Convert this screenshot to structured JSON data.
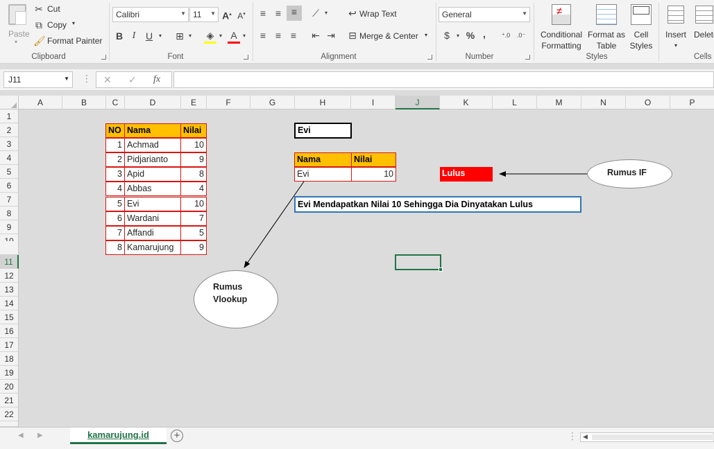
{
  "clipboard": {
    "paste": "Paste",
    "cut": "Cut",
    "copy": "Copy",
    "format_painter": "Format Painter",
    "label": "Clipboard"
  },
  "font": {
    "name": "Calibri",
    "size": "11",
    "label": "Font"
  },
  "alignment": {
    "wrap_text": "Wrap Text",
    "merge_center": "Merge & Center",
    "label": "Alignment"
  },
  "number": {
    "format": "General",
    "label": "Number",
    "currency": "$",
    "percent": "%",
    "comma": ","
  },
  "styles": {
    "conditional": "Conditional",
    "formatting": "Formatting",
    "format_as": "Format as",
    "table": "Table",
    "cell": "Cell",
    "cell_styles": "Styles",
    "label": "Styles"
  },
  "cells": {
    "insert": "Insert",
    "delete": "Delete",
    "label": "Cells"
  },
  "formula_bar": {
    "name_box": "J11",
    "fx": "fx",
    "value": ""
  },
  "columns": [
    "A",
    "B",
    "C",
    "D",
    "E",
    "F",
    "G",
    "H",
    "I",
    "J",
    "K",
    "L",
    "M",
    "N",
    "O",
    "P"
  ],
  "rows": [
    "1",
    "2",
    "3",
    "4",
    "5",
    "6",
    "7",
    "8",
    "9",
    "10",
    "11",
    "12",
    "13",
    "14",
    "15",
    "16",
    "17",
    "18",
    "19",
    "20",
    "21",
    "22"
  ],
  "data_table": {
    "headers": [
      "NO",
      "Nama",
      "Nilai"
    ],
    "rows": [
      [
        "1",
        "Achmad",
        "10"
      ],
      [
        "2",
        "Pidjarianto",
        "9"
      ],
      [
        "3",
        "Apid",
        "8"
      ],
      [
        "4",
        "Abbas",
        "4"
      ],
      [
        "5",
        "Evi",
        "10"
      ],
      [
        "6",
        "Wardani",
        "7"
      ],
      [
        "7",
        "Affandi",
        "5"
      ],
      [
        "8",
        "Kamarujung",
        "9"
      ]
    ]
  },
  "lookup_input": "Evi",
  "result_table": {
    "headers": [
      "Nama",
      "Nilai"
    ],
    "row": [
      "Evi",
      "10"
    ]
  },
  "if_result": "Lulus",
  "summary_text": "Evi Mendapatkan Nilai 10 Sehingga Dia Dinyatakan Lulus",
  "callouts": {
    "if_label": "Rumus IF",
    "vlookup_line1": "Rumus",
    "vlookup_line2": "Vlookup"
  },
  "sheet_tab": "kamarujung.id",
  "colors": {
    "header_fill": "#ffc000",
    "table_border": "#d9140f",
    "lulus_fill": "#ff0000",
    "summary_border": "#2e75b6",
    "selection": "#217346"
  }
}
